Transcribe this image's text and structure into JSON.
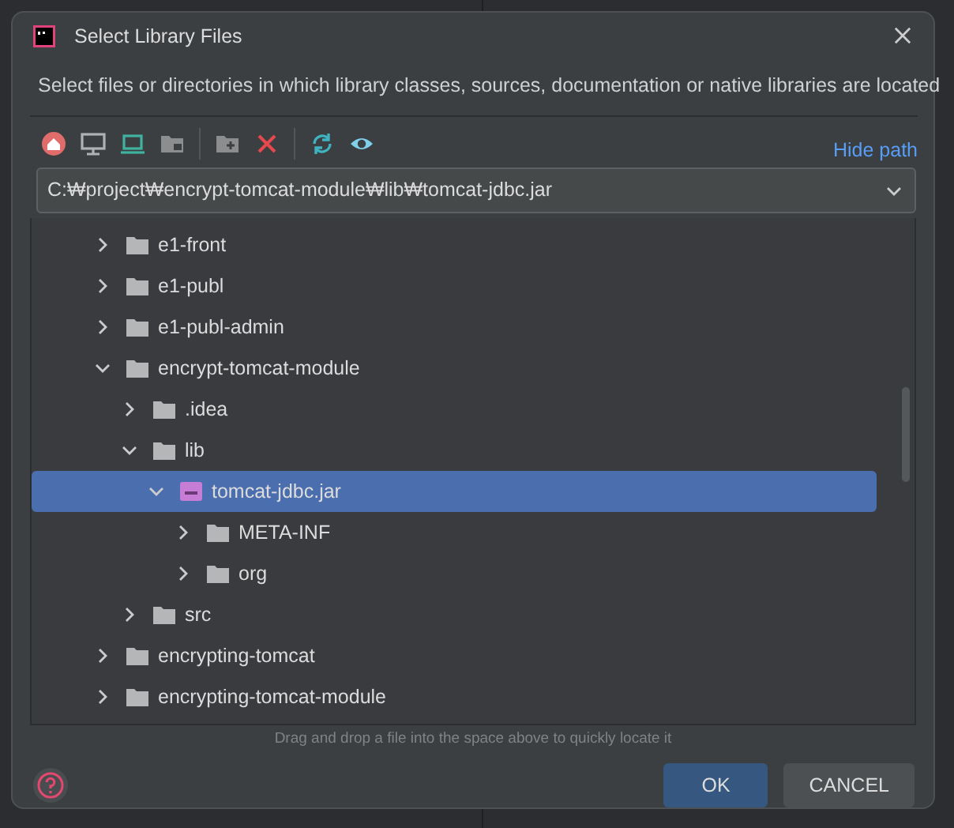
{
  "window": {
    "title": "Select Library Files"
  },
  "description": "Select files or directories in which library classes, sources, documentation or native libraries are located",
  "toolbar": {
    "hide_path_link": "Hide path"
  },
  "path_field": {
    "value": "C:₩project₩encrypt-tomcat-module₩lib₩tomcat-jdbc.jar"
  },
  "tree": [
    {
      "label": "e1-front",
      "kind": "folder",
      "expanded": false,
      "selected": false
    },
    {
      "label": "e1-publ",
      "kind": "folder",
      "expanded": false,
      "selected": false
    },
    {
      "label": "e1-publ-admin",
      "kind": "folder",
      "expanded": false,
      "selected": false
    },
    {
      "label": "encrypt-tomcat-module",
      "kind": "folder",
      "expanded": true,
      "selected": false,
      "children": [
        {
          "label": ".idea",
          "kind": "folder",
          "expanded": false,
          "selected": false
        },
        {
          "label": "lib",
          "kind": "folder",
          "expanded": true,
          "selected": false,
          "children": [
            {
              "label": "tomcat-jdbc.jar",
              "kind": "jar",
              "expanded": true,
              "selected": true,
              "children": [
                {
                  "label": "META-INF",
                  "kind": "folder",
                  "expanded": false,
                  "selected": false
                },
                {
                  "label": "org",
                  "kind": "folder",
                  "expanded": false,
                  "selected": false
                }
              ]
            }
          ]
        },
        {
          "label": "src",
          "kind": "folder",
          "expanded": false,
          "selected": false
        }
      ]
    },
    {
      "label": "encrypting-tomcat",
      "kind": "folder",
      "expanded": false,
      "selected": false
    },
    {
      "label": "encrypting-tomcat-module",
      "kind": "folder",
      "expanded": false,
      "selected": false
    }
  ],
  "drop_hint": "Drag and drop a file into the space above to quickly locate it",
  "buttons": [
    {
      "label": "OK",
      "kind": "primary"
    },
    {
      "label": "CANCEL",
      "kind": "secondary"
    }
  ]
}
